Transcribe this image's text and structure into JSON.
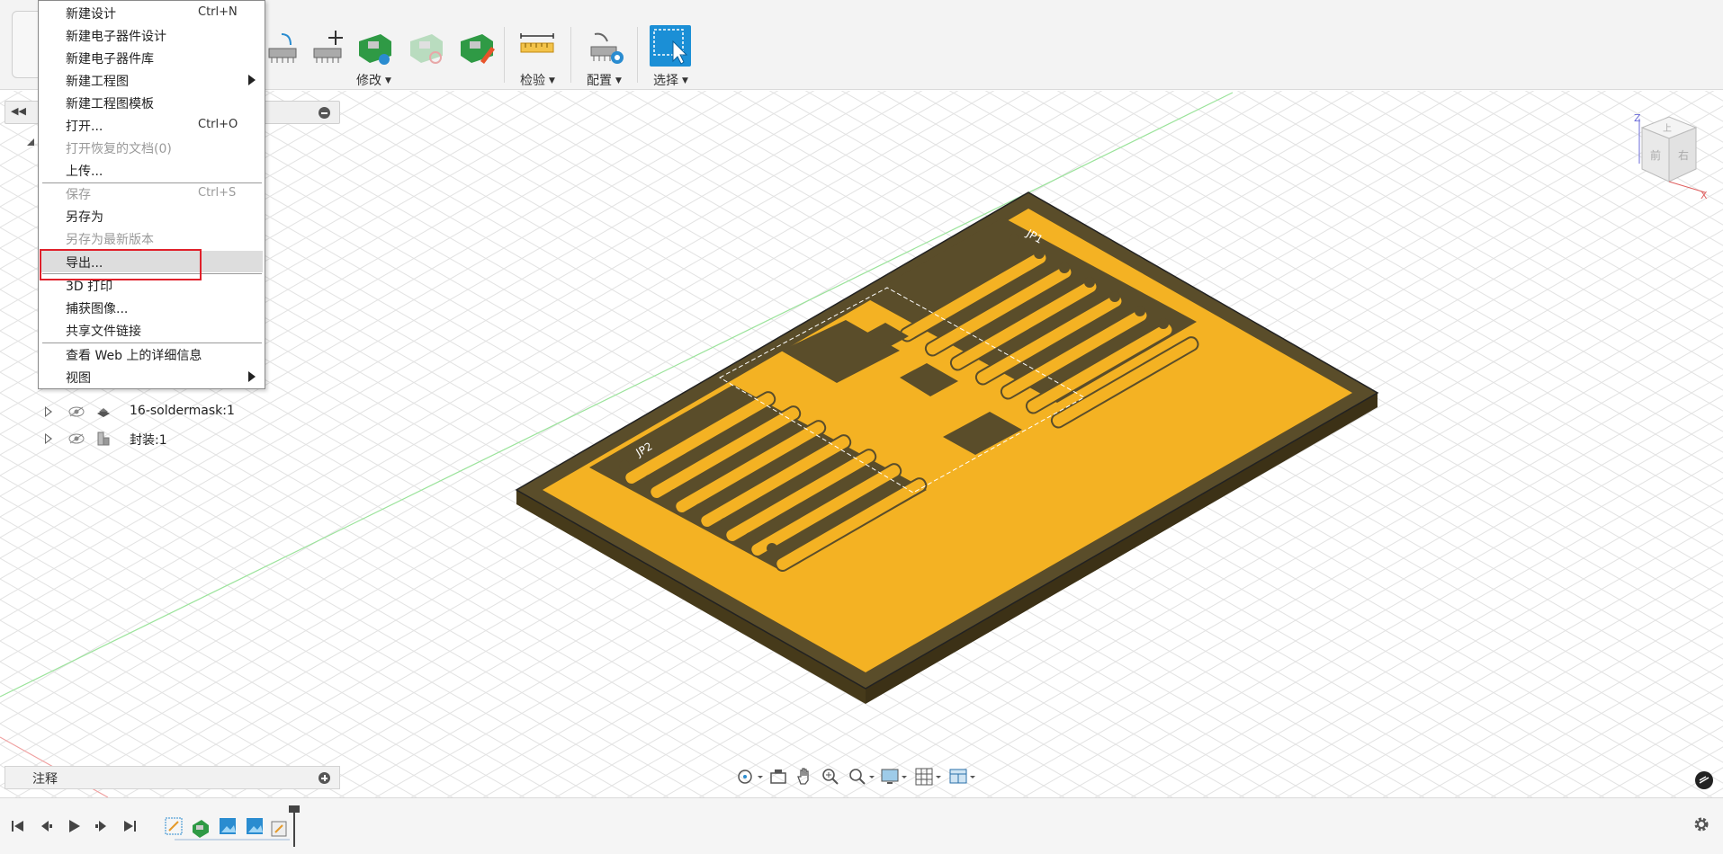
{
  "toolbar": {
    "groups": [
      {
        "label": "修改"
      },
      {
        "label": "检验"
      },
      {
        "label": "配置"
      },
      {
        "label": "选择"
      }
    ]
  },
  "file_menu": {
    "items": [
      {
        "label": "新建设计",
        "shortcut": "Ctrl+N",
        "disabled": false
      },
      {
        "label": "新建电子器件设计",
        "shortcut": "",
        "disabled": false
      },
      {
        "label": "新建电子器件库",
        "shortcut": "",
        "disabled": false
      },
      {
        "label": "新建工程图",
        "shortcut": "",
        "disabled": false,
        "submenu": true
      },
      {
        "label": "新建工程图模板",
        "shortcut": "",
        "disabled": false
      },
      {
        "label": "打开...",
        "shortcut": "Ctrl+O",
        "disabled": false
      },
      {
        "label": "打开恢复的文档(0)",
        "shortcut": "",
        "disabled": true
      },
      {
        "label": "上传...",
        "shortcut": "",
        "disabled": false
      },
      {
        "label": "保存",
        "shortcut": "Ctrl+S",
        "disabled": true
      },
      {
        "label": "另存为",
        "shortcut": "",
        "disabled": false
      },
      {
        "label": "另存为最新版本",
        "shortcut": "",
        "disabled": true
      },
      {
        "label": "导出...",
        "shortcut": "",
        "disabled": false,
        "highlighted": true
      },
      {
        "label": "3D 打印",
        "shortcut": "",
        "disabled": false
      },
      {
        "label": "捕获图像...",
        "shortcut": "",
        "disabled": false
      },
      {
        "label": "共享文件链接",
        "shortcut": "",
        "disabled": false
      },
      {
        "label": "查看 Web 上的详细信息",
        "shortcut": "",
        "disabled": false
      },
      {
        "label": "视图",
        "shortcut": "",
        "disabled": false,
        "submenu": true
      }
    ]
  },
  "browser": {
    "tree": [
      {
        "name": "16-soldermask:1",
        "icon": "pcb-icon"
      },
      {
        "name": "封装:1",
        "icon": "component-icon"
      }
    ]
  },
  "notes_panel": {
    "label": "注释"
  },
  "pcb": {
    "silkscreen_labels": [
      "JP1",
      "JP2"
    ],
    "board_color": "#f4b223",
    "substrate_color": "#5a4d2a"
  },
  "viewcube": {
    "faces": [
      "上",
      "前",
      "右"
    ],
    "axes": [
      "Z",
      "X"
    ]
  },
  "colors": {
    "accent": "#1b8fd6",
    "highlight_box": "#e0202a"
  }
}
